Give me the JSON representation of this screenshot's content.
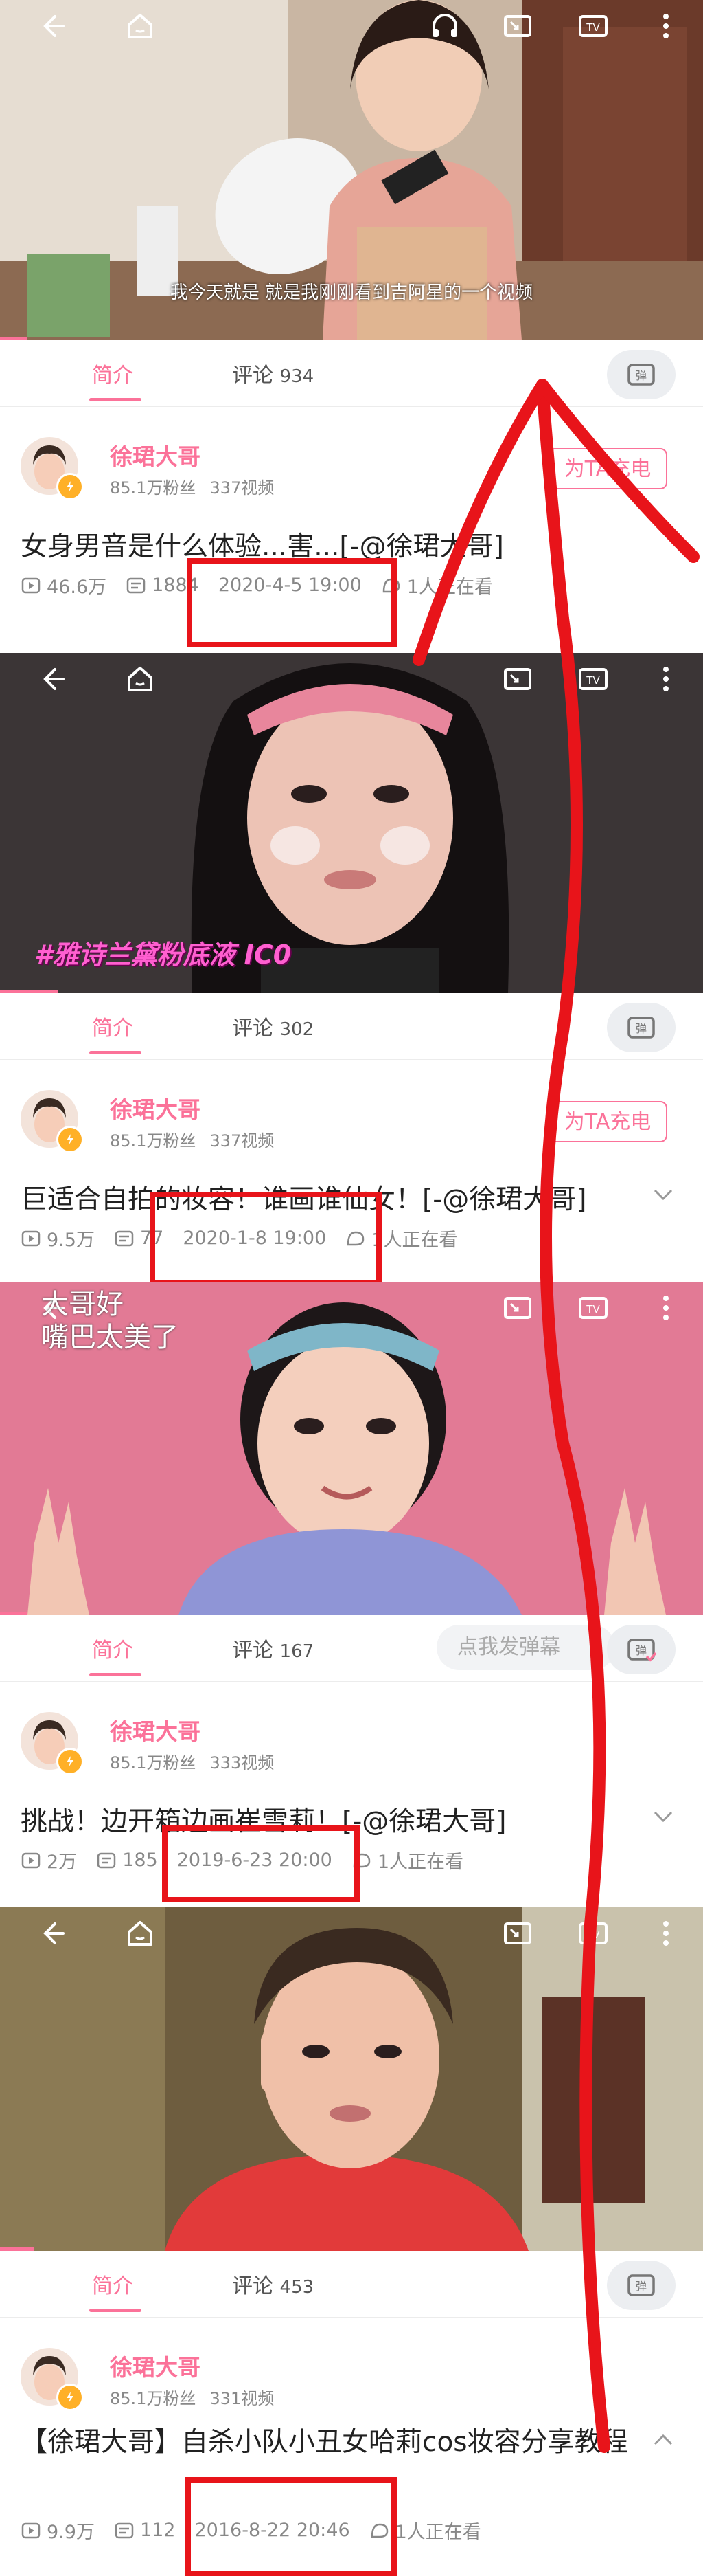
{
  "colors": {
    "accent": "#fb7299",
    "annotation_red": "#e8141a",
    "muted": "#888888"
  },
  "icons": [
    "back-arrow-icon",
    "home-icon",
    "headphones-icon",
    "cast-icon",
    "tv-icon",
    "more-icon",
    "play-count-icon",
    "danmaku-count-icon",
    "watching-icon",
    "danmaku-toggle-icon",
    "chevron-icon"
  ],
  "panels": [
    {
      "subtitle": "我今天就是  就是我刚刚看到吉阿星的一个视频",
      "tab_intro": "简介",
      "tab_comments": "评论",
      "comment_count": "934",
      "uploader": "徐珺大哥",
      "followers": "85.1万粉丝",
      "video_count": "337视频",
      "charge_label": "为TA充电",
      "title": "女身男音是什么体验...害...[-@徐珺大哥]",
      "views": "46.6万",
      "danmaku": "1884",
      "date": "2020-4-5 19:00",
      "watching": "1人正在看"
    },
    {
      "tab_intro": "简介",
      "tab_comments": "评论",
      "comment_count": "302",
      "uploader": "徐珺大哥",
      "followers": "85.1万粉丝",
      "video_count": "337视频",
      "charge_label": "为TA充电",
      "overlay_text": "#雅诗兰黛粉底液 IC0",
      "title": "巨适合自拍的妆容！谁画谁仙女！[-@徐珺大哥]",
      "views": "9.5万",
      "danmaku": "77",
      "date": "2020-1-8 19:00",
      "watching": "1人正在看"
    },
    {
      "overlay_caption": "嘴巴太美了",
      "overlay_caption_top": "大哥好",
      "tab_intro": "简介",
      "tab_comments": "评论",
      "comment_count": "167",
      "danmaku_placeholder": "点我发弹幕",
      "uploader": "徐珺大哥",
      "followers": "85.1万粉丝",
      "video_count": "333视频",
      "title": "挑战！边开箱边画崔雪莉！[-@徐珺大哥]",
      "views": "2万",
      "danmaku": "185",
      "date": "2019-6-23 20:00",
      "watching": "1人正在看"
    },
    {
      "tab_intro": "简介",
      "tab_comments": "评论",
      "comment_count": "453",
      "uploader": "徐珺大哥",
      "followers": "85.1万粉丝",
      "video_count": "331视频",
      "title": "【徐珺大哥】自杀小队小丑女哈莉cos妆容分享教程",
      "views": "9.9万",
      "danmaku": "112",
      "date": "2016-8-22 20:46",
      "watching": "1人正在看"
    }
  ]
}
